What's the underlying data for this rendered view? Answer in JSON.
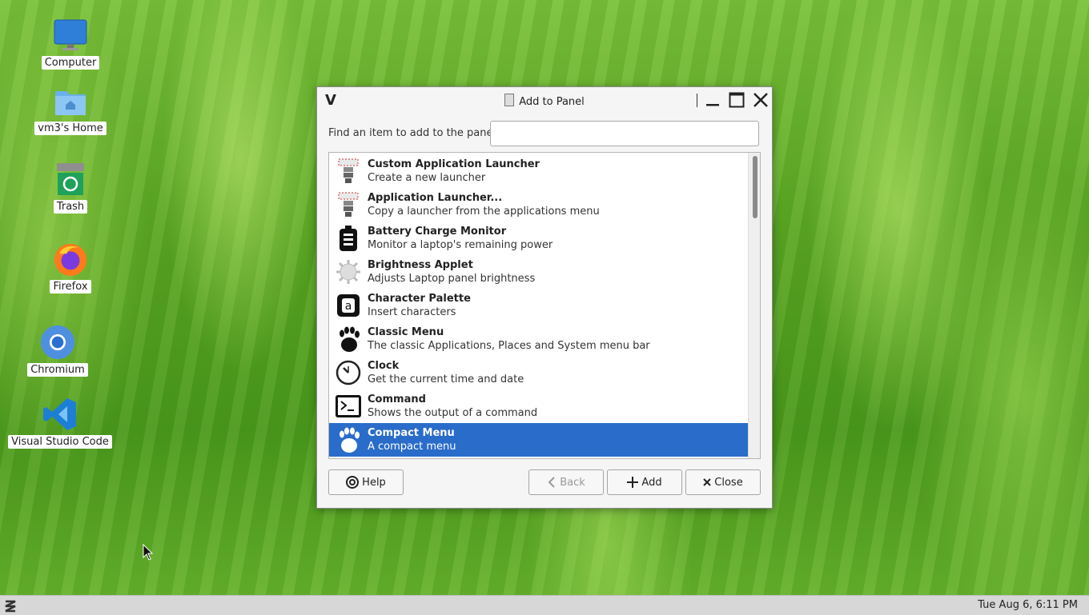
{
  "desktop": {
    "icons": [
      {
        "label": "Computer"
      },
      {
        "label": "vm3's Home"
      },
      {
        "label": "Trash"
      },
      {
        "label": "Firefox"
      },
      {
        "label": "Chromium"
      },
      {
        "label": "Visual Studio Code"
      }
    ]
  },
  "dialog": {
    "title": "Add to Panel",
    "find_label": "Find an item to add to the panel:",
    "find_value": "",
    "items": [
      {
        "name": "Custom Application Launcher",
        "desc": "Create a new launcher",
        "icon": "launcher-icon"
      },
      {
        "name": "Application Launcher...",
        "desc": "Copy a launcher from the applications menu",
        "icon": "launcher-icon"
      },
      {
        "name": "Battery Charge Monitor",
        "desc": "Monitor a laptop's remaining power",
        "icon": "battery-icon"
      },
      {
        "name": "Brightness Applet",
        "desc": "Adjusts Laptop panel brightness",
        "icon": "brightness-icon"
      },
      {
        "name": "Character Palette",
        "desc": "Insert characters",
        "icon": "character-palette-icon"
      },
      {
        "name": "Classic Menu",
        "desc": "The classic Applications, Places and System menu bar",
        "icon": "gnome-foot-icon"
      },
      {
        "name": "Clock",
        "desc": "Get the current time and date",
        "icon": "clock-icon"
      },
      {
        "name": "Command",
        "desc": "Shows the output of a command",
        "icon": "terminal-icon"
      },
      {
        "name": "Compact Menu",
        "desc": "A compact menu",
        "icon": "gnome-foot-icon",
        "selected": true
      }
    ],
    "buttons": {
      "help": "Help",
      "back": "Back",
      "add": "Add",
      "close": "Close"
    },
    "selection_color": "#2a6cc9"
  },
  "taskbar": {
    "clock": "Tue Aug  6,  6:11 PM"
  }
}
